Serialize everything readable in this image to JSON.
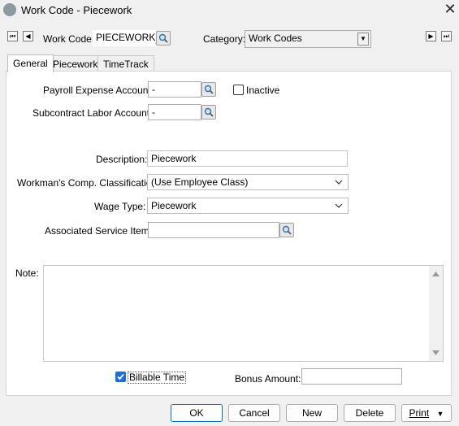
{
  "window": {
    "title": "Work Code - Piecework",
    "close_glyph": "✕"
  },
  "nav": {
    "first_glyph": "⏮",
    "prev_glyph": "◀",
    "next_glyph": "▶",
    "last_glyph": "⏭"
  },
  "header": {
    "work_code_label": "Work Code:",
    "work_code_value": "PIECEWORK",
    "category_label": "Category:",
    "category_value": "Work Codes"
  },
  "tabs": [
    {
      "label": "General"
    },
    {
      "label": "Piecework"
    },
    {
      "label": "TimeTrack"
    }
  ],
  "general": {
    "payroll_label": "Payroll Expense Account:",
    "payroll_value": "-",
    "inactive_label": "Inactive",
    "inactive_checked": false,
    "subcontract_label": "Subcontract Labor Account:",
    "subcontract_value": "-",
    "description_label": "Description:",
    "description_value": "Piecework",
    "workmans_label": "Workman's Comp. Classification:",
    "workmans_value": "(Use Employee Class)",
    "wage_type_label": "Wage Type:",
    "wage_type_value": "Piecework",
    "service_item_label": "Associated Service Item:",
    "service_item_value": "",
    "note_label": "Note:",
    "note_value": "",
    "billable_label": "Billable Time",
    "billable_checked": true,
    "bonus_label": "Bonus Amount:",
    "bonus_value": ""
  },
  "buttons": {
    "ok": "OK",
    "cancel": "Cancel",
    "new": "New",
    "delete": "Delete",
    "print": "Print"
  },
  "colors": {
    "accent": "#1f6fd0",
    "primary_border": "#0f6cbd"
  },
  "icons": [
    "app-icon",
    "close-icon",
    "first-record-icon",
    "prev-record-icon",
    "next-record-icon",
    "last-record-icon",
    "magnifier-icon",
    "dropdown-arrow-icon",
    "chevron-down-icon",
    "checkmark-icon",
    "scroll-up-icon",
    "scroll-down-icon"
  ]
}
